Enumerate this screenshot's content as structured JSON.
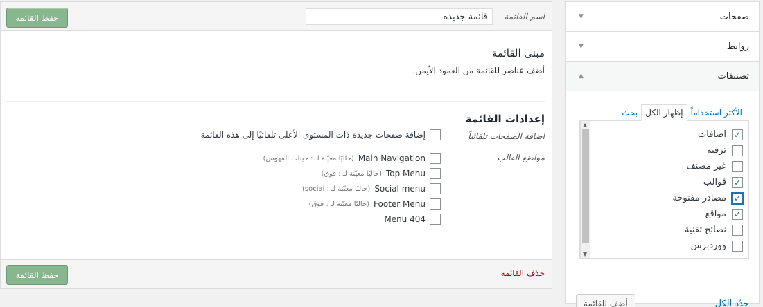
{
  "accordion": {
    "items": [
      {
        "title": "صفحات",
        "state": "closed"
      },
      {
        "title": "روابط",
        "state": "closed"
      },
      {
        "title": "تصنيفات",
        "state": "open"
      }
    ],
    "tabs": [
      {
        "label": "الأكثر استخداماً",
        "active": false
      },
      {
        "label": "إظهار الكل",
        "active": true
      },
      {
        "label": "بحث",
        "active": false
      }
    ],
    "categories": [
      {
        "label": "اضافات",
        "checked": true
      },
      {
        "label": "ترفيه",
        "checked": false
      },
      {
        "label": "غير مصنف",
        "checked": false
      },
      {
        "label": "قوالب",
        "checked": true
      },
      {
        "label": "مصادر مفتوحة",
        "checked": true
      },
      {
        "label": "مواقع",
        "checked": true
      },
      {
        "label": "نصائح تقنية",
        "checked": false
      },
      {
        "label": "ووردبرس",
        "checked": false
      }
    ],
    "select_all_label": "حدّد الكل",
    "add_to_menu_label": "أضف للقائمة"
  },
  "header": {
    "menu_name_label": "اسم القائمة",
    "menu_name_value": "قائمة جديدة",
    "save_label": "حفظ القائمة"
  },
  "structure": {
    "title": "مبنى القائمة",
    "description": "أضف عناصر للقائمة من العمود الأيمن."
  },
  "settings": {
    "title": "إعدادات القائمة",
    "auto_add_label": "اضافة الصفحات تلقائياً",
    "auto_add_option": "إضافة صفحات جديدة ذات المستوى الأعلى تلقائيًا إلى هذه القائمة",
    "locations_label": "مواضع القالب",
    "locations": [
      {
        "name": "Main Navigation",
        "note": "(حاليًا معيّنة لـ : جينات المهوس)"
      },
      {
        "name": "Top Menu",
        "note": "(حاليًا معيّنة لـ : فوق)"
      },
      {
        "name": "Social menu",
        "note": "(حاليًا معيّنة لـ : social)"
      },
      {
        "name": "Footer Menu",
        "note": "(حاليًا معيّنة لـ : فوق)"
      },
      {
        "name": "Menu 404",
        "note": ""
      }
    ]
  },
  "footer": {
    "delete_label": "حذف القائمة",
    "save_label": "حفظ القائمة"
  },
  "colors": {
    "primary_button": "#88b68f",
    "link": "#0073aa",
    "delete_link": "#a00000"
  },
  "icons": {
    "accordion_closed": "triangle-down-icon",
    "accordion_open": "triangle-up-icon",
    "checkmark": "checkmark-icon"
  }
}
